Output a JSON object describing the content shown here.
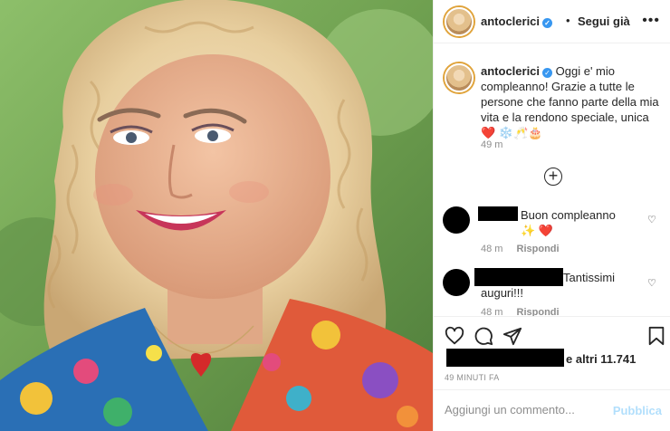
{
  "post": {
    "image_alt": "",
    "username": "antoclerici",
    "header_dot": "•",
    "follow_label": "Segui già",
    "more_icon": "more-horizontal-icon",
    "caption_username": "antoclerici",
    "caption_text": "Oggi e' mio compleanno! Grazie a tutte le persone che fanno parte della mia vita e la rendono speciale, unica❤️ ❄️🥂🎂",
    "caption_time": "49 m",
    "load_more_icon": "plus-circle-icon"
  },
  "comments": [
    {
      "text": "Buon compleanno ✨ ❤️",
      "time": "48 m",
      "reply": "Rispondi"
    },
    {
      "text": "Tantissimi auguri!!!",
      "time": "48 m",
      "reply": "Rispondi"
    }
  ],
  "actions": {
    "like_icon": "heart-icon",
    "comment_icon": "comment-icon",
    "share_icon": "send-icon",
    "save_icon": "bookmark-icon"
  },
  "likes_text": "e altri 11.741",
  "time_ago": "49 MINUTI FA",
  "comment_bar": {
    "placeholder": "Aggiungi un commento...",
    "publish_label": "Pubblica"
  },
  "colors": {
    "accent": "#3897f0",
    "publish_disabled": "#b2dffc",
    "muted": "#8e8e8e",
    "text": "#262626"
  }
}
